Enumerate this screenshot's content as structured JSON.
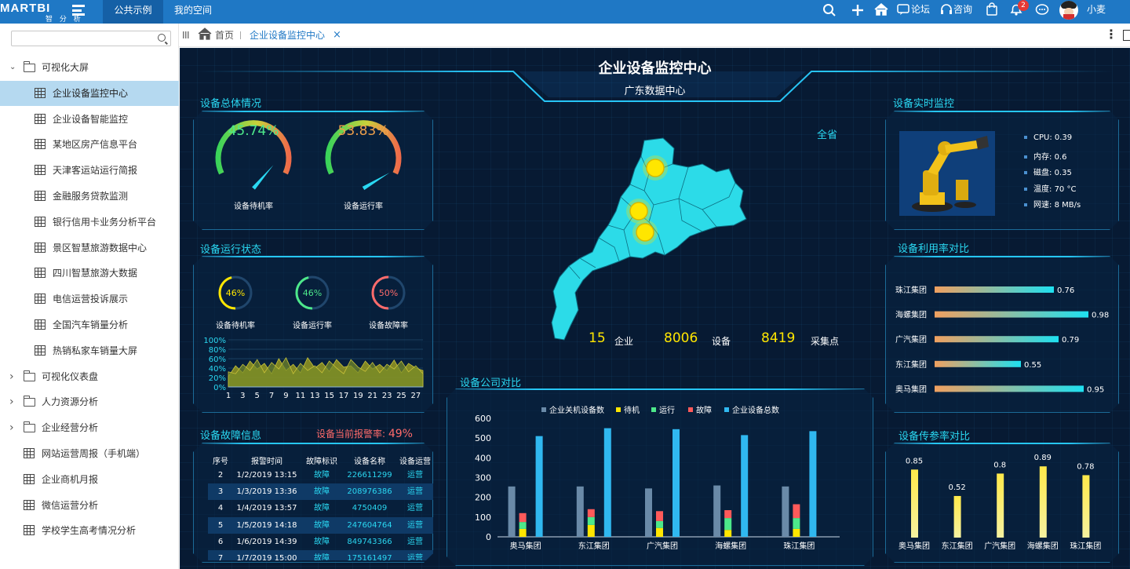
{
  "app": {
    "logo": "MARTBI",
    "logo_sub": "智 分 析",
    "tabs": [
      "公共示例",
      "我的空间"
    ],
    "right": {
      "forum": "论坛",
      "consult": "咨询",
      "notif_count": "2",
      "user": "小麦"
    }
  },
  "sidebar": {
    "search": {
      "value": "",
      "placeholder": ""
    },
    "items": [
      {
        "label": "可视化大屏",
        "type": "folder",
        "expanded": true
      },
      {
        "label": "企业设备监控中心",
        "type": "report",
        "selected": true
      },
      {
        "label": "企业设备智能监控",
        "type": "report"
      },
      {
        "label": "某地区房产信息平台",
        "type": "report"
      },
      {
        "label": "天津客运站运行简报",
        "type": "report"
      },
      {
        "label": "金融服务贷款监测",
        "type": "report"
      },
      {
        "label": "银行信用卡业务分析平台",
        "type": "report"
      },
      {
        "label": "景区智慧旅游数据中心",
        "type": "report"
      },
      {
        "label": "四川智慧旅游大数据",
        "type": "report"
      },
      {
        "label": "电信运营投诉展示",
        "type": "report"
      },
      {
        "label": "全国汽车销量分析",
        "type": "report"
      },
      {
        "label": "热销私家车销量大屏",
        "type": "report"
      },
      {
        "label": "可视化仪表盘",
        "type": "folder",
        "expanded": false
      },
      {
        "label": "人力资源分析",
        "type": "folder",
        "expanded": false
      },
      {
        "label": "企业经营分析",
        "type": "folder",
        "expanded": false
      },
      {
        "label": "网站运营周报（手机端）",
        "type": "report"
      },
      {
        "label": "企业商机月报",
        "type": "report"
      },
      {
        "label": "微信运营分析",
        "type": "report"
      },
      {
        "label": "学校学生高考情况分析",
        "type": "report"
      }
    ]
  },
  "tabbar": {
    "home": "首页",
    "active_tab": "企业设备监控中心"
  },
  "dashboard": {
    "title": "企业设备监控中心",
    "subtitle": "广东数据中心",
    "overview": {
      "title": "设备总体情况",
      "gauges": [
        {
          "value": "45.74%",
          "fraction": 0.4574,
          "label": "设备待机率",
          "color": "#4de88a"
        },
        {
          "value": "53.83%",
          "fraction": 0.5383,
          "label": "设备运行率",
          "color": "#f0a04a"
        }
      ]
    },
    "status": {
      "title": "设备运行状态",
      "rings": [
        {
          "value": "46%",
          "fraction": 0.46,
          "label": "设备待机率",
          "color": "#ffe600"
        },
        {
          "value": "46%",
          "fraction": 0.46,
          "label": "设备运行率",
          "color": "#4de88a"
        },
        {
          "value": "50%",
          "fraction": 0.5,
          "label": "设备故障率",
          "color": "#ff6b6b"
        }
      ]
    },
    "map": {
      "region_label": "全省",
      "stats": [
        {
          "num": "15",
          "label": "企业"
        },
        {
          "num": "8006",
          "label": "设备"
        },
        {
          "num": "8419",
          "label": "采集点"
        }
      ]
    },
    "realtime": {
      "title": "设备实时监控",
      "metrics": [
        {
          "label": "CPU: ",
          "value": "0.39"
        },
        {
          "label": "内存: ",
          "value": "0.6"
        },
        {
          "label": "磁盘: ",
          "value": "0.35"
        },
        {
          "label": "温度: ",
          "value": "70 °C"
        },
        {
          "label": "网速: ",
          "value": "8 MB/s"
        }
      ]
    },
    "faults": {
      "title": "设备故障信息",
      "alarm_label": "设备当前报警率: ",
      "alarm_value": "49%",
      "columns": [
        "序号",
        "报警时间",
        "故障标识",
        "设备名称",
        "设备运营"
      ],
      "rows": [
        [
          "2",
          "1/2/2019 13:15",
          "故障",
          "226611299",
          "运营"
        ],
        [
          "3",
          "1/3/2019 13:36",
          "故障",
          "208976386",
          "运营"
        ],
        [
          "4",
          "1/4/2019 13:57",
          "故障",
          "4750409",
          "运营"
        ],
        [
          "5",
          "1/5/2019 14:18",
          "故障",
          "247604764",
          "运营"
        ],
        [
          "6",
          "1/6/2019 14:39",
          "故障",
          "849743366",
          "运营"
        ],
        [
          "7",
          "1/7/2019 15:00",
          "故障",
          "175161497",
          "运营"
        ]
      ]
    },
    "utilization_title": "设备利用率对比",
    "transfer_title": "设备传参率对比",
    "company_title": "设备公司对比"
  },
  "colors": {
    "topbar": "#1f78c5",
    "cyan": "#2ad8f2",
    "yellow": "#ffe600",
    "bg": "#071a33",
    "map_fill": "#2cdbe8"
  },
  "chart_data": [
    {
      "type": "area",
      "id": "status_area",
      "x": [
        1,
        2,
        3,
        4,
        5,
        6,
        7,
        8,
        9,
        10,
        11,
        12,
        13,
        14,
        15,
        16,
        17,
        18,
        19,
        20,
        21,
        22,
        23,
        24,
        25,
        26,
        27,
        28
      ],
      "xticks": [
        1,
        3,
        5,
        7,
        9,
        11,
        13,
        15,
        17,
        19,
        21,
        23,
        25,
        27
      ],
      "series": [
        {
          "values": [
            22,
            45,
            30,
            55,
            38,
            50,
            28,
            60,
            35,
            48,
            30,
            62,
            40,
            52,
            33,
            58,
            42,
            45,
            30,
            55,
            38,
            48,
            35,
            57,
            30,
            50,
            40,
            35
          ]
        },
        {
          "values": [
            32,
            28,
            48,
            35,
            58,
            30,
            52,
            38,
            62,
            28,
            50,
            35,
            45,
            30,
            55,
            40,
            28,
            58,
            42,
            33,
            52,
            30,
            48,
            38,
            55,
            32,
            45,
            28
          ]
        }
      ],
      "yticks": [
        "0%",
        "20%",
        "40%",
        "60%",
        "80%",
        "100%"
      ],
      "ylim": [
        0,
        100
      ]
    },
    {
      "type": "bar",
      "id": "company",
      "title": "",
      "categories": [
        "奥马集团",
        "东江集团",
        "广汽集团",
        "海螺集团",
        "珠江集团"
      ],
      "series": [
        {
          "name": "企业关机设备数",
          "color": "#6a8aa8",
          "values": [
            255,
            255,
            245,
            260,
            255
          ]
        },
        {
          "name": "待机",
          "color": "#ffe600",
          "values": [
            40,
            60,
            45,
            35,
            40
          ]
        },
        {
          "name": "运行",
          "color": "#4de88a",
          "values": [
            35,
            40,
            35,
            60,
            55
          ]
        },
        {
          "name": "故障",
          "color": "#ff5a5a",
          "values": [
            45,
            40,
            50,
            40,
            70
          ]
        },
        {
          "name": "企业设备总数",
          "color": "#30b8f0",
          "values": [
            510,
            550,
            545,
            515,
            535
          ]
        }
      ],
      "ylim": [
        0,
        600
      ],
      "yticks": [
        0,
        100,
        200,
        300,
        400,
        500,
        600
      ]
    },
    {
      "type": "bar",
      "id": "utilization",
      "orientation": "horizontal",
      "categories": [
        "珠江集团",
        "海螺集团",
        "广汽集团",
        "东江集团",
        "奥马集团"
      ],
      "values": [
        0.76,
        0.98,
        0.79,
        0.55,
        0.95
      ],
      "labels": [
        "0.76",
        "0.98",
        "0.79",
        "0.55",
        "0.95"
      ],
      "xlim": [
        0,
        1
      ]
    },
    {
      "type": "bar",
      "id": "transfer",
      "categories": [
        "奥马集团",
        "东江集团",
        "广汽集团",
        "海螺集团",
        "珠江集团"
      ],
      "values": [
        0.85,
        0.52,
        0.8,
        0.89,
        0.78
      ],
      "labels": [
        "0.85",
        "0.52",
        "0.8",
        "0.89",
        "0.78"
      ],
      "ylim": [
        0,
        1
      ]
    }
  ]
}
